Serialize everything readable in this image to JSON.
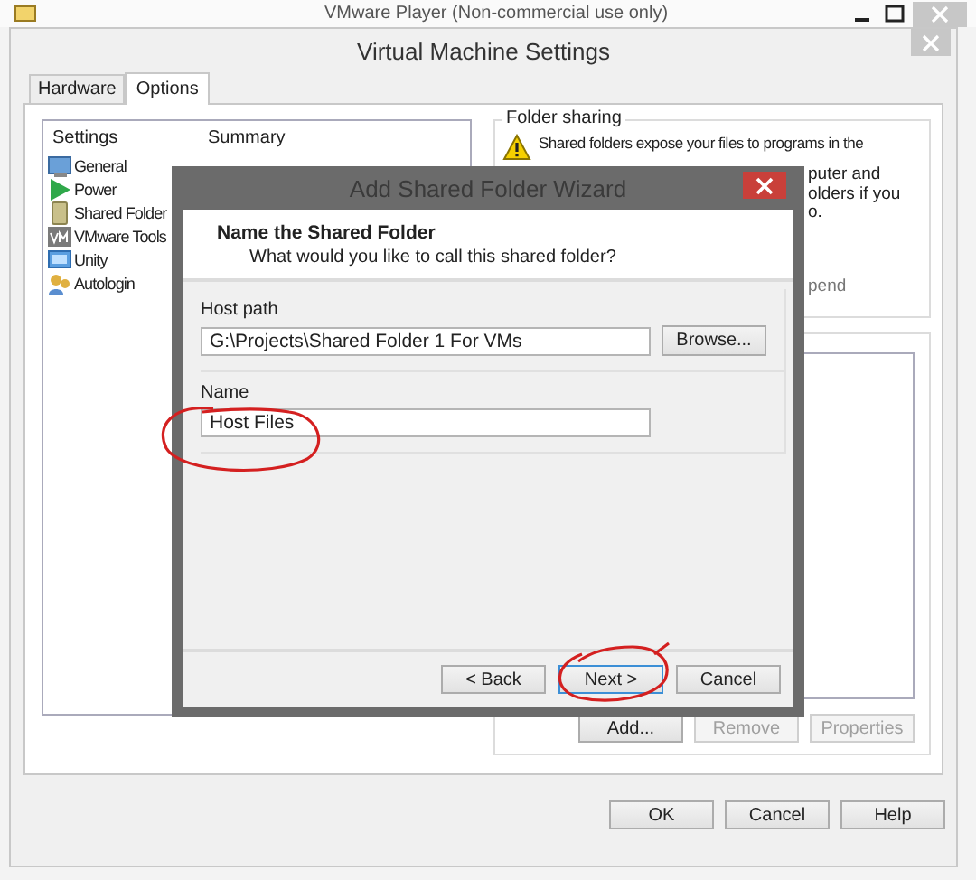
{
  "app_window": {
    "title": "VMware Player (Non-commercial use only)"
  },
  "dialog": {
    "title": "Virtual Machine Settings",
    "tabs": [
      {
        "label": "Hardware",
        "selected": false
      },
      {
        "label": "Options",
        "selected": true
      }
    ],
    "settings_list": {
      "columns": [
        "Settings",
        "Summary"
      ],
      "items": [
        "General",
        "Power",
        "Shared Folder",
        "VMware Tools",
        "Unity",
        "Autologin"
      ]
    },
    "folder_sharing": {
      "title": "Folder sharing",
      "lines": [
        "Shared folders expose your files to programs in the",
        "puter and",
        "olders if you",
        "o.",
        "pend"
      ]
    },
    "folder_buttons": [
      {
        "label": "Add...",
        "disabled": false
      },
      {
        "label": "Remove",
        "disabled": true
      },
      {
        "label": "Properties",
        "disabled": true
      }
    ],
    "buttons": [
      "OK",
      "Cancel",
      "Help"
    ]
  },
  "wizard": {
    "title": "Add Shared Folder Wizard",
    "heading": "Name the Shared Folder",
    "subheading": "What would you like to call this shared folder?",
    "host_path": {
      "label": "Host path",
      "value": "G:\\Projects\\Shared Folder 1 For VMs",
      "button": "Browse..."
    },
    "name": {
      "label": "Name",
      "value": "Host Files"
    },
    "buttons": [
      {
        "label": "< Back",
        "default": false
      },
      {
        "label": "Next >",
        "default": true
      },
      {
        "label": "Cancel",
        "default": false
      }
    ]
  }
}
